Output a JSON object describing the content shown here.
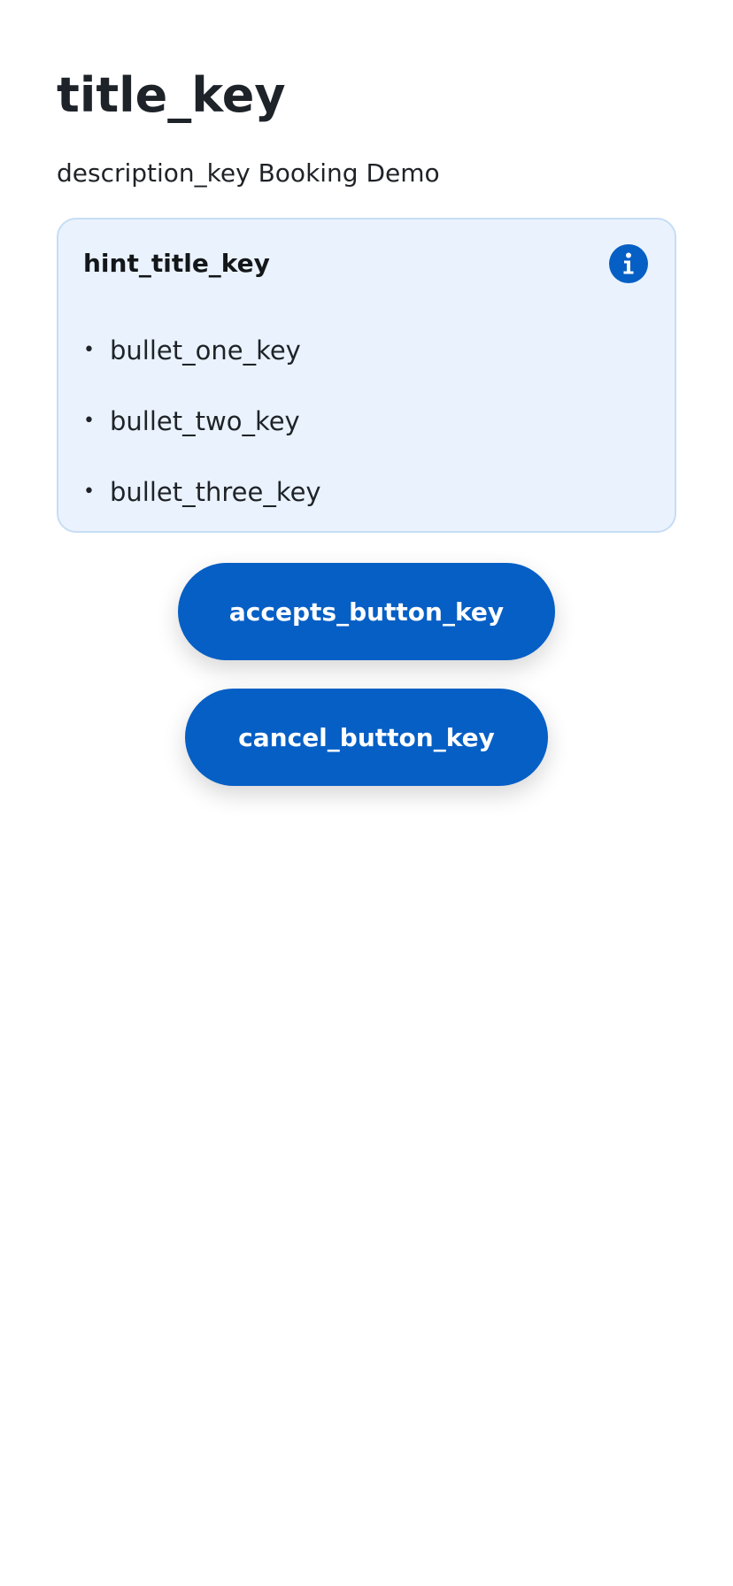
{
  "header": {
    "title": "title_key",
    "description": "description_key Booking Demo"
  },
  "hint": {
    "title": "hint_title_key",
    "icon": "info-icon",
    "bullets": [
      "bullet_one_key",
      "bullet_two_key",
      "bullet_three_key"
    ]
  },
  "actions": {
    "accept_label": "accepts_button_key",
    "cancel_label": "cancel_button_key"
  },
  "colors": {
    "primary": "#065fc5",
    "hint_background": "#eaf3fd",
    "hint_border": "#c7ddf5",
    "text": "#1f2328"
  }
}
